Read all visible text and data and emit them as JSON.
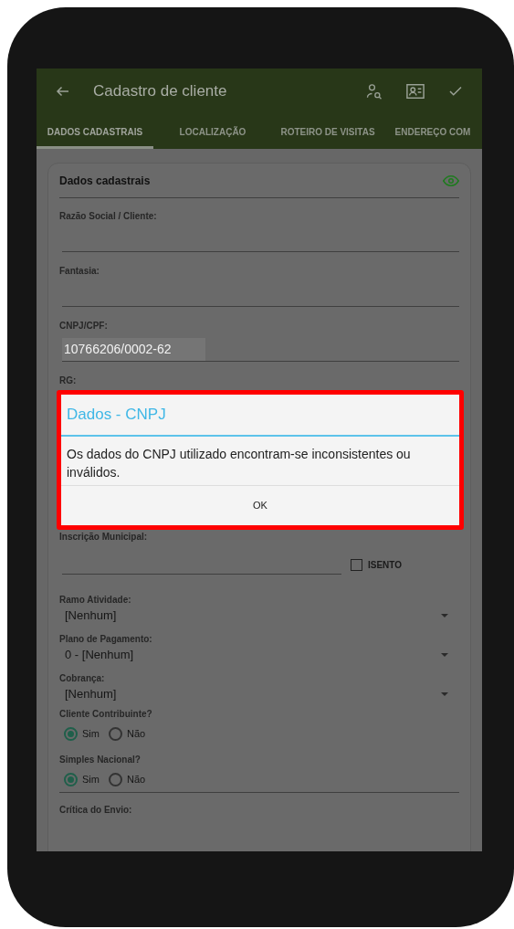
{
  "app_bar": {
    "title": "Cadastro de cliente"
  },
  "tabs": [
    {
      "label": "DADOS CADASTRAIS",
      "selected": true
    },
    {
      "label": "LOCALIZAÇÃO",
      "selected": false
    },
    {
      "label": "ROTEIRO DE VISITAS",
      "selected": false
    },
    {
      "label": "ENDEREÇO COM",
      "selected": false
    }
  ],
  "card": {
    "title": "Dados cadastrais",
    "fields": [
      {
        "kind": "text",
        "label": "Razão Social / Cliente:"
      },
      {
        "kind": "text",
        "label": "Fantasia:"
      },
      {
        "kind": "text",
        "label": "CNPJ/CPF:",
        "value": "10766206/0002-62",
        "disabled": true
      },
      {
        "kind": "hidden",
        "label": "RG:"
      },
      {
        "kind": "text_check",
        "label": "Inscrição Municipal:",
        "checkbox": {
          "label": "ISENTO",
          "checked": false
        }
      },
      {
        "kind": "select",
        "label": "Ramo Atividade:",
        "value": "[Nenhum]"
      },
      {
        "kind": "select",
        "label": "Plano de Pagamento:",
        "value": "0 - [Nenhum]"
      },
      {
        "kind": "select",
        "label": "Cobrança:",
        "value": "[Nenhum]"
      },
      {
        "kind": "radio",
        "label": "Cliente Contribuinte?",
        "options": [
          {
            "label": "Sim",
            "selected": true
          },
          {
            "label": "Não",
            "selected": false
          }
        ]
      },
      {
        "kind": "radio",
        "label": "Simples Nacional?",
        "options": [
          {
            "label": "Sim",
            "selected": true
          },
          {
            "label": "Não",
            "selected": false
          }
        ]
      },
      {
        "kind": "section",
        "label": "Crítica do Envio:"
      }
    ]
  },
  "dialog": {
    "title": "Dados - CNPJ",
    "message": "Os dados do CNPJ utilizado encontram-se inconsistentes ou inválidos.",
    "buttons": [
      "OK"
    ]
  }
}
